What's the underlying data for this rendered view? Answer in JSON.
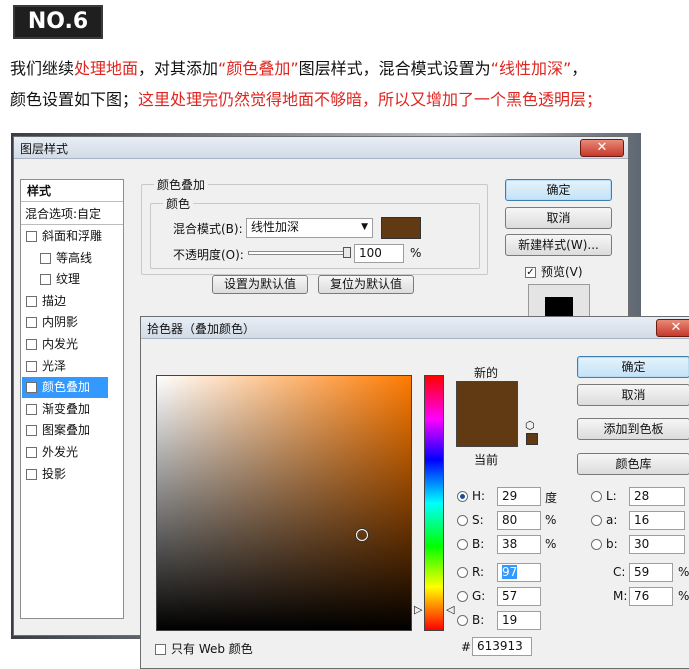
{
  "header": {
    "badge": "NO.6",
    "line1": [
      {
        "text": "我们继续",
        "red": false
      },
      {
        "text": "处理地面",
        "red": true
      },
      {
        "text": "，对其添加",
        "red": false
      },
      {
        "text": "“颜色叠加”",
        "red": true
      },
      {
        "text": "图层样式，混合模式设置为",
        "red": false
      },
      {
        "text": "“线性加深”",
        "red": true
      },
      {
        "text": "，",
        "red": false
      }
    ],
    "line2": [
      {
        "text": "颜色设置如下图；",
        "red": false
      },
      {
        "text": "这里处理完仍然觉得地面不够暗，所以又增加了一个黑色透明层；",
        "red": true
      }
    ]
  },
  "layer_style": {
    "title": "图层样式",
    "styles_header": "样式",
    "blend_options": "混合选项:自定",
    "items": [
      {
        "label": "斜面和浮雕",
        "checked": false,
        "indent": false
      },
      {
        "label": "等高线",
        "checked": false,
        "indent": true
      },
      {
        "label": "纹理",
        "checked": false,
        "indent": true
      },
      {
        "label": "描边",
        "checked": false,
        "indent": false
      },
      {
        "label": "内阴影",
        "checked": false,
        "indent": false
      },
      {
        "label": "内发光",
        "checked": false,
        "indent": false
      },
      {
        "label": "光泽",
        "checked": false,
        "indent": false
      },
      {
        "label": "颜色叠加",
        "checked": true,
        "indent": false,
        "selected": true
      },
      {
        "label": "渐变叠加",
        "checked": false,
        "indent": false
      },
      {
        "label": "图案叠加",
        "checked": false,
        "indent": false
      },
      {
        "label": "外发光",
        "checked": false,
        "indent": false
      },
      {
        "label": "投影",
        "checked": false,
        "indent": false
      }
    ],
    "section_title": "颜色叠加",
    "subsection_title": "颜色",
    "blend_mode_label": "混合模式(B):",
    "blend_mode_value": "线性加深",
    "opacity_label": "不透明度(O):",
    "opacity_value": "100",
    "opacity_unit": "%",
    "opacity_fraction": 1.0,
    "overlay_color": "#613913",
    "set_default": "设置为默认值",
    "reset_default": "复位为默认值",
    "ok": "确定",
    "cancel": "取消",
    "new_style": "新建样式(W)...",
    "preview_label": "预览(V)",
    "preview_checked": true
  },
  "color_picker": {
    "title": "拾色器（叠加颜色）",
    "new_label": "新的",
    "current_label": "当前",
    "new_color": "#613913",
    "current_color": "#613913",
    "ok": "确定",
    "cancel": "取消",
    "add_swatch": "添加到色板",
    "color_library": "颜色库",
    "web_only": "只有 Web 颜色",
    "hue_color": "#ff7a00",
    "hsb": [
      {
        "key": "H:",
        "value": "29",
        "unit": "度",
        "on": true
      },
      {
        "key": "S:",
        "value": "80",
        "unit": "%",
        "on": false
      },
      {
        "key": "B:",
        "value": "38",
        "unit": "%",
        "on": false
      }
    ],
    "lab": [
      {
        "key": "L:",
        "value": "28",
        "on": false
      },
      {
        "key": "a:",
        "value": "16",
        "on": false
      },
      {
        "key": "b:",
        "value": "30",
        "on": false
      }
    ],
    "rgb": [
      {
        "key": "R:",
        "value": "97",
        "on": false,
        "highlight": true
      },
      {
        "key": "G:",
        "value": "57",
        "on": false,
        "highlight": false
      },
      {
        "key": "B:",
        "value": "19",
        "on": false,
        "highlight": false
      }
    ],
    "cmyk": [
      {
        "key": "C:",
        "value": "59",
        "unit": "%"
      },
      {
        "key": "M:",
        "value": "76",
        "unit": "%"
      }
    ],
    "hex_label": "#",
    "hex_value": "613913",
    "saturation_fraction": 0.8,
    "brightness_fraction": 0.38,
    "hue_fraction": 0.08
  }
}
